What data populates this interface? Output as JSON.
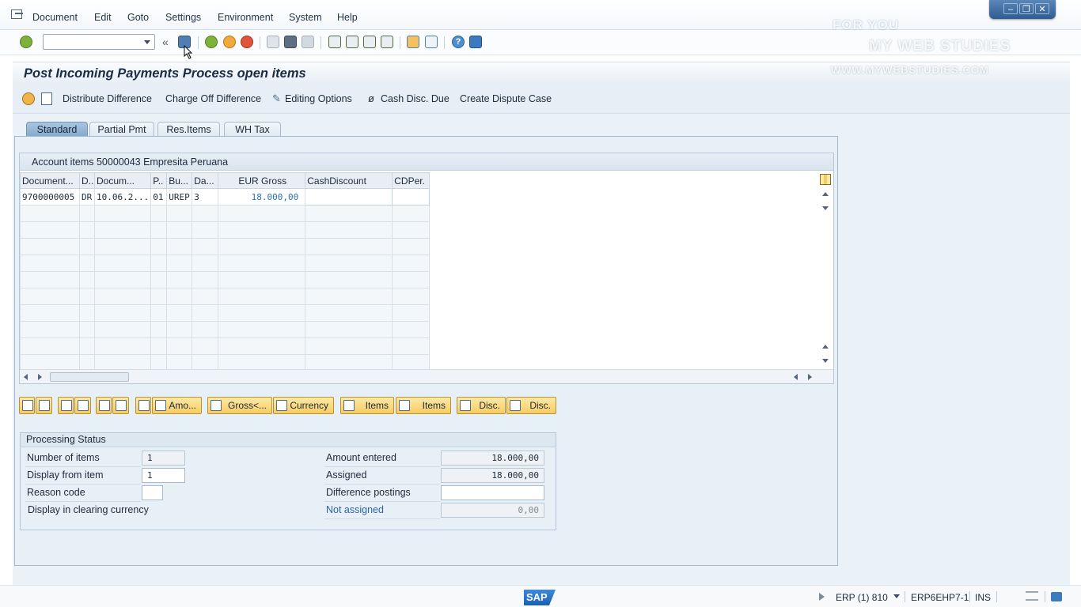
{
  "menu": {
    "items": [
      "Document",
      "Edit",
      "Goto",
      "Settings",
      "Environment",
      "System",
      "Help"
    ]
  },
  "window_controls": [
    "minimize",
    "restore",
    "close"
  ],
  "toolbar": {
    "command_field_value": "",
    "icons": [
      "enter-icon",
      "command-field-dropdown",
      "collapse-icon",
      "save-icon",
      "back-icon",
      "exit-icon",
      "cancel-icon",
      "print-icon",
      "find-icon",
      "find-next-icon",
      "first-page-icon",
      "previous-page-icon",
      "next-page-icon",
      "last-page-icon",
      "create-session-icon",
      "shortcut-icon",
      "help-icon",
      "customize-layout-icon"
    ]
  },
  "watermark": {
    "line1": "FOR YOU",
    "line2": "MY WEB STUDIES",
    "line3": "WWW.MYWEBSTUDIES.COM"
  },
  "title": "Post Incoming Payments Process open items",
  "app_toolbar": {
    "distribute": "Distribute Difference",
    "charge_off": "Charge Off Difference",
    "editing_options": "Editing Options",
    "cash_disc_due": "Cash Disc. Due",
    "create_dispute": "Create Dispute Case"
  },
  "tabs": [
    {
      "label": "Standard",
      "active": true
    },
    {
      "label": "Partial Pmt",
      "active": false
    },
    {
      "label": "Res.Items",
      "active": false
    },
    {
      "label": "WH Tax",
      "active": false
    }
  ],
  "grid": {
    "caption": "Account items 50000043 Empresita Peruana",
    "columns": [
      "Document...",
      "D..",
      "Docum...",
      "P..",
      "Bu...",
      "Da...",
      "EUR Gross",
      "CashDiscount",
      "CDPer."
    ],
    "rows": [
      [
        "9700000005",
        "DR",
        "10.06.2...",
        "01",
        "UREP",
        "3",
        "18.000,00",
        "",
        ""
      ]
    ]
  },
  "grid_buttons": {
    "amount": "Amo...",
    "gross": "Gross<...",
    "currency": "Currency",
    "items1": "Items",
    "items2": "Items",
    "disc1": "Disc.",
    "disc2": "Disc."
  },
  "processing_status": {
    "caption": "Processing Status",
    "number_of_items_label": "Number of items",
    "number_of_items": "1",
    "display_from_item_label": "Display from item",
    "display_from_item": "1",
    "reason_code_label": "Reason code",
    "reason_code": "",
    "display_clearing_currency_label": "Display in clearing currency",
    "amount_entered_label": "Amount entered",
    "amount_entered": "18.000,00",
    "assigned_label": "Assigned",
    "assigned": "18.000,00",
    "difference_postings_label": "Difference postings",
    "difference_postings": "",
    "not_assigned_label": "Not assigned",
    "not_assigned": "0,00"
  },
  "status_bar": {
    "logo": "SAP",
    "system": "ERP (1) 810",
    "server": "ERP6EHP7-1",
    "mode": "INS"
  },
  "colors": {
    "accent_blue": "#2c63a8",
    "button_gold": "#f7cc62",
    "tab_active": "#7fa7cb"
  }
}
